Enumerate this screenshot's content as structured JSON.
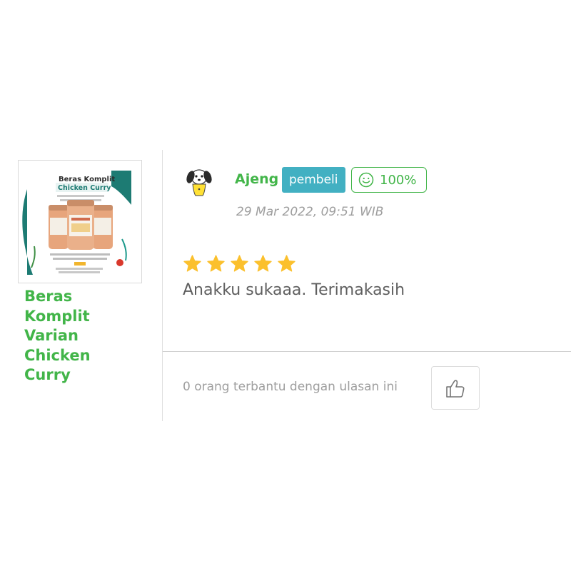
{
  "product": {
    "name": "Beras Komplit Varian Chicken Curry",
    "thumbnail": {
      "title_line1": "Beras Komplit",
      "title_line2": "Chicken Curry",
      "colors": {
        "teal": "#1d7b73",
        "jar": "#e7a57c",
        "accent": "#1e9a8c"
      }
    }
  },
  "review": {
    "reviewer_name": "Ajeng",
    "buyer_badge": "pembeli",
    "rating_badge": "100%",
    "date": "29 Mar 2022, 09:51 WIB",
    "stars": 5,
    "text": "Anakku sukaaa. Terimakasih"
  },
  "helpful": {
    "text": "0 orang terbantu dengan ulasan ini"
  },
  "colors": {
    "green": "#42b549",
    "badge_teal": "#42b0c2",
    "star": "#fbc02d",
    "muted": "#9e9e9e"
  },
  "icons": {
    "avatar": "cartoon-dog-avatar-icon",
    "smile": "smile-icon",
    "star": "star-icon",
    "like": "thumbs-up-icon"
  }
}
